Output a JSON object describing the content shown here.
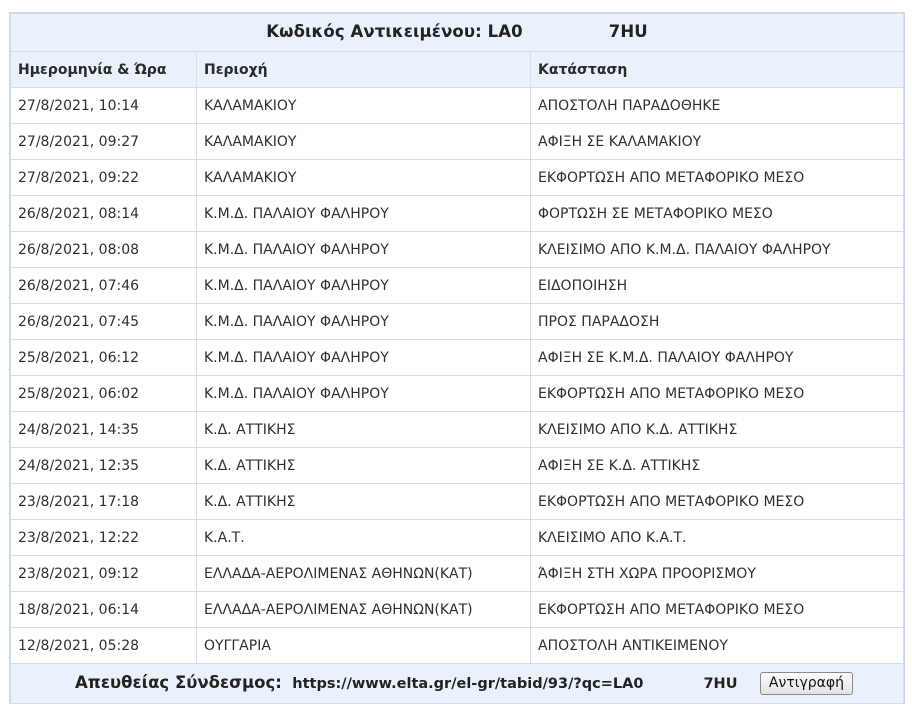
{
  "title": {
    "label": "Κωδικός Αντικειμένου:",
    "code_prefix": "LA0",
    "code_suffix": "7HU"
  },
  "columns": {
    "date": "Ημερομηνία & Ώρα",
    "area": "Περιοχή",
    "status": "Κατάσταση"
  },
  "rows": [
    {
      "date": "27/8/2021, 10:14",
      "area": "ΚΑΛΑΜΑΚΙΟΥ",
      "status": "ΑΠΟΣΤΟΛΗ ΠΑΡΑΔΟΘΗΚΕ"
    },
    {
      "date": "27/8/2021, 09:27",
      "area": "ΚΑΛΑΜΑΚΙΟΥ",
      "status": "ΑΦΙΞΗ ΣΕ ΚΑΛΑΜΑΚΙΟΥ"
    },
    {
      "date": "27/8/2021, 09:22",
      "area": "ΚΑΛΑΜΑΚΙΟΥ",
      "status": "ΕΚΦΟΡΤΩΣΗ ΑΠΟ ΜΕΤΑΦΟΡΙΚΟ ΜΕΣΟ"
    },
    {
      "date": "26/8/2021, 08:14",
      "area": "Κ.Μ.Δ. ΠΑΛΑΙΟΥ ΦΑΛΗΡΟΥ",
      "status": "ΦΟΡΤΩΣΗ ΣΕ ΜΕΤΑΦΟΡΙΚΟ ΜΕΣΟ"
    },
    {
      "date": "26/8/2021, 08:08",
      "area": "Κ.Μ.Δ. ΠΑΛΑΙΟΥ ΦΑΛΗΡΟΥ",
      "status": "ΚΛΕΙΣΙΜΟ ΑΠΟ Κ.Μ.Δ. ΠΑΛΑΙΟΥ ΦΑΛΗΡΟΥ"
    },
    {
      "date": "26/8/2021, 07:46",
      "area": "Κ.Μ.Δ. ΠΑΛΑΙΟΥ ΦΑΛΗΡΟΥ",
      "status": "ΕΙΔΟΠΟΙΗΣΗ"
    },
    {
      "date": "26/8/2021, 07:45",
      "area": "Κ.Μ.Δ. ΠΑΛΑΙΟΥ ΦΑΛΗΡΟΥ",
      "status": "ΠΡΟΣ ΠΑΡΑΔΟΣΗ"
    },
    {
      "date": "25/8/2021, 06:12",
      "area": "Κ.Μ.Δ. ΠΑΛΑΙΟΥ ΦΑΛΗΡΟΥ",
      "status": "ΑΦΙΞΗ ΣΕ Κ.Μ.Δ. ΠΑΛΑΙΟΥ ΦΑΛΗΡΟΥ"
    },
    {
      "date": "25/8/2021, 06:02",
      "area": "Κ.Μ.Δ. ΠΑΛΑΙΟΥ ΦΑΛΗΡΟΥ",
      "status": "ΕΚΦΟΡΤΩΣΗ ΑΠΟ ΜΕΤΑΦΟΡΙΚΟ ΜΕΣΟ"
    },
    {
      "date": "24/8/2021, 14:35",
      "area": "Κ.Δ. ΑΤΤΙΚΗΣ",
      "status": "ΚΛΕΙΣΙΜΟ ΑΠΟ Κ.Δ. ΑΤΤΙΚΗΣ"
    },
    {
      "date": "24/8/2021, 12:35",
      "area": "Κ.Δ. ΑΤΤΙΚΗΣ",
      "status": "ΑΦΙΞΗ ΣΕ Κ.Δ. ΑΤΤΙΚΗΣ"
    },
    {
      "date": "23/8/2021, 17:18",
      "area": "Κ.Δ. ΑΤΤΙΚΗΣ",
      "status": "ΕΚΦΟΡΤΩΣΗ ΑΠΟ ΜΕΤΑΦΟΡΙΚΟ ΜΕΣΟ"
    },
    {
      "date": "23/8/2021, 12:22",
      "area": "Κ.Α.Τ.",
      "status": "ΚΛΕΙΣΙΜΟ ΑΠΟ Κ.Α.Τ."
    },
    {
      "date": "23/8/2021, 09:12",
      "area": "ΕΛΛΑΔΑ-ΑΕΡΟΛΙΜΕΝΑΣ ΑΘΗΝΩΝ(ΚΑΤ)",
      "status": "ΆΦΙΞΗ ΣΤΗ ΧΩΡΑ ΠΡΟΟΡΙΣΜΟΥ"
    },
    {
      "date": "18/8/2021, 06:14",
      "area": "ΕΛΛΑΔΑ-ΑΕΡΟΛΙΜΕΝΑΣ ΑΘΗΝΩΝ(ΚΑΤ)",
      "status": "ΕΚΦΟΡΤΩΣΗ ΑΠΟ ΜΕΤΑΦΟΡΙΚΟ ΜΕΣΟ"
    },
    {
      "date": "12/8/2021, 05:28",
      "area": "ΟΥΓΓΑΡΙΑ",
      "status": "ΑΠΟΣΤΟΛΗ ΑΝΤΙΚΕΙΜΕΝΟΥ"
    }
  ],
  "footer": {
    "label": "Απευθείας Σύνδεσμος:",
    "url_prefix": "https://www.elta.gr/el-gr/tabid/93/?qc=LA0",
    "url_suffix": "7HU",
    "copy_label": "Αντιγραφή"
  },
  "colors": {
    "header_bg": "#e9f1fb",
    "border": "#d4dde8",
    "text": "#2f2f2f"
  }
}
